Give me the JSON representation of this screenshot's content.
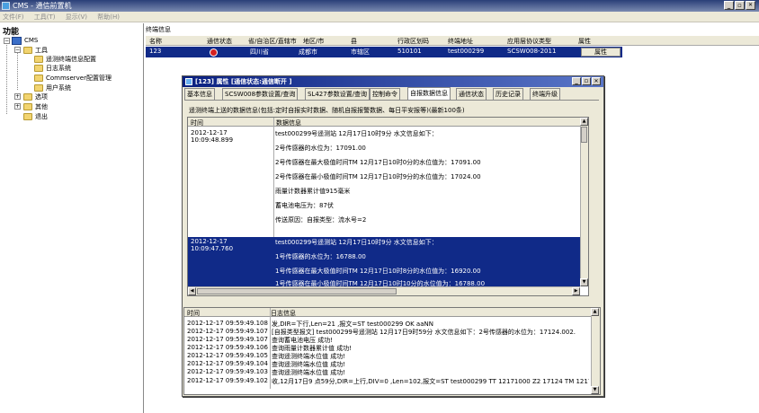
{
  "window": {
    "title": "CMS - 通信前置机",
    "minimize": "_",
    "restore": "▫",
    "close": "✕"
  },
  "menu": [
    "文件(F)",
    "工具(T)",
    "显示(V)",
    "帮助(H)"
  ],
  "sidebar": {
    "title": "功能",
    "root": "CMS",
    "items": [
      {
        "label": "工具",
        "toggle": "−"
      },
      {
        "label": "遥测终端信息配置"
      },
      {
        "label": "日志系统"
      },
      {
        "label": "Commserver配置管理"
      },
      {
        "label": "用户系统"
      },
      {
        "label": "选项",
        "toggle": "+"
      },
      {
        "label": "其他",
        "toggle": "+"
      },
      {
        "label": "退出"
      }
    ]
  },
  "grid": {
    "caption": "终端信息",
    "columns": [
      "名称",
      "通信状态",
      "省/自治区/直辖市",
      "地区/市",
      "县",
      "行政区划码",
      "终端地址",
      "应用层协议类型",
      "属性"
    ],
    "row": {
      "name": "123",
      "province": "四川省",
      "city": "成都市",
      "county": "市辖区",
      "code": "510101",
      "addr": "test000299",
      "protocol": "SCSW008-2011",
      "action": "属性"
    }
  },
  "dialog": {
    "title": "[123] 属性     [通信状态:通信断开 ]",
    "tabs": [
      "基本信息",
      "SCSW008参数设置/查询",
      "SL427参数设置/查询",
      "控制命令",
      "自报数据信息",
      "通信状态",
      "历史记录",
      "终端升级"
    ],
    "active_tab": 4,
    "subheading": "遥测终端上送的数据信息(包括:定时自报实时数据、随机自报报警数据、每日平安报等)(最新100条)",
    "columns": [
      "时间",
      "数据信息"
    ],
    "entries": [
      {
        "time": "2012-12-17",
        "time2": "10:09:48.899",
        "lines": [
          "test000299号遥测站 12月17日10时9分 水文信息如下：",
          "2号传感器的水位为：17091.00",
          "2号传感器在最大极值时间TM 12月17日10时0分的水位值为：17091.00",
          "2号传感器在最小极值时间TM 12月17日10时9分的水位值为：17024.00",
          "雨量计数器累计值915毫米",
          "蓄电池电压为：87伏",
          "传送原因：自报类型：流水号=2"
        ]
      },
      {
        "time": "2012-12-17",
        "time2": "10:09:47.760",
        "lines": [
          "test000299号遥测站 12月17日10时9分 水文信息如下：",
          "1号传感器的水位为：16788.00",
          "1号传感器在最大极值时间TM 12月17日10时8分的水位值为：16920.00",
          "1号传感器在最小极值时间TM 12月17日10时10分的水位值为：16788.00"
        ]
      }
    ],
    "log": {
      "columns": [
        "时间",
        "日志信息"
      ],
      "rows": [
        {
          "time": "2012-12-17 09:59:49.108",
          "msg": "发,DIR=下行,Len=21 ,报文=ST test000299 OK aaNN"
        },
        {
          "time": "2012-12-17 09:59:49.107",
          "msg": "[自报类型报文] test000299号遥测站 12月17日9时59分 水文信息如下：2号传感器的水位为：17124.002."
        },
        {
          "time": "2012-12-17 09:59:49.107",
          "msg": "查询蓄电池电压 成功!"
        },
        {
          "time": "2012-12-17 09:59:49.106",
          "msg": "查询雨量计数器累计值 成功!"
        },
        {
          "time": "2012-12-17 09:59:49.105",
          "msg": "查询遥测终端水位值 成功!"
        },
        {
          "time": "2012-12-17 09:59:49.104",
          "msg": "查询遥测终端水位值 成功!"
        },
        {
          "time": "2012-12-17 09:59:49.103",
          "msg": "查询遥测终端水位值 成功!"
        },
        {
          "time": "2012-12-17 09:59:49.102",
          "msg": "收,12月17日9 点59分,DIR=上行,DIV=0 ,Len=102,报文=ST test000299 TT 12171000 Z2 17124 TM 1217107"
        }
      ]
    }
  },
  "colors": {
    "selection": "#102a88",
    "title_start": "#2a3f78",
    "dialog_title": "#0a2080",
    "status_red": "#d42020"
  }
}
